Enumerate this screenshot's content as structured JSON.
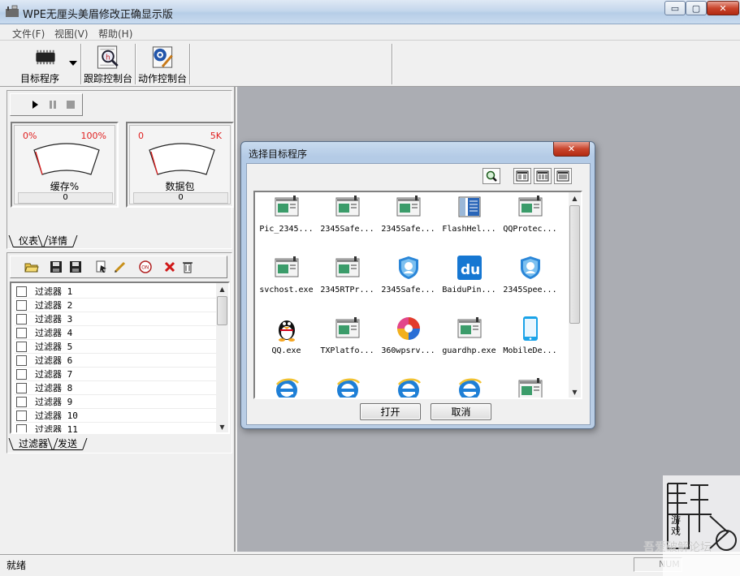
{
  "window": {
    "title": "WPE无厘头美眉修改正确显示版",
    "min_glyph": "▭",
    "max_glyph": "▢",
    "close_glyph": "✕"
  },
  "menu": [
    "文件(F)",
    "视图(V)",
    "帮助(H)"
  ],
  "toolbar": {
    "target_label": "目标程序",
    "trace_label": "跟踪控制台",
    "action_label": "动作控制台"
  },
  "gauges": [
    {
      "name": "缓存%",
      "min": "0%",
      "max": "100%",
      "value": "0"
    },
    {
      "name": "数据包",
      "min": "0",
      "max": "5K",
      "value": "0"
    }
  ],
  "top_tabs": [
    "仪表",
    "详情"
  ],
  "filters": [
    "过滤器 1",
    "过滤器 2",
    "过滤器 3",
    "过滤器 4",
    "过滤器 5",
    "过滤器 6",
    "过滤器 7",
    "过滤器 8",
    "过滤器 9",
    "过滤器 10",
    "过滤器 11"
  ],
  "bottom_tabs": [
    "过滤器",
    "发送"
  ],
  "dialog": {
    "title": "选择目标程序",
    "close_glyph": "✕",
    "open_label": "打开",
    "cancel_label": "取消",
    "programs": [
      {
        "name": "Pic_2345...",
        "icon": "window-app-icon"
      },
      {
        "name": "2345Safe...",
        "icon": "window-app-icon"
      },
      {
        "name": "2345Safe...",
        "icon": "window-app-icon"
      },
      {
        "name": "FlashHel...",
        "icon": "flash-helper-icon"
      },
      {
        "name": "QQProtec...",
        "icon": "window-app-icon"
      },
      {
        "name": "svchost.exe",
        "icon": "window-app-icon"
      },
      {
        "name": "2345RTPr...",
        "icon": "window-app-icon"
      },
      {
        "name": "2345Safe...",
        "icon": "shield-icon"
      },
      {
        "name": "BaiduPin...",
        "icon": "baidu-du-icon"
      },
      {
        "name": "2345Spee...",
        "icon": "shield-icon"
      },
      {
        "name": "QQ.exe",
        "icon": "qq-penguin-icon"
      },
      {
        "name": "TXPlatfo...",
        "icon": "window-app-icon"
      },
      {
        "name": "360wpsrv...",
        "icon": "360-icon"
      },
      {
        "name": "guardhp.exe",
        "icon": "window-app-icon"
      },
      {
        "name": "MobileDe...",
        "icon": "mobile-phone-icon"
      },
      {
        "name": "",
        "icon": "ie-icon"
      },
      {
        "name": "",
        "icon": "ie-icon"
      },
      {
        "name": "",
        "icon": "ie-icon"
      },
      {
        "name": "",
        "icon": "ie-icon"
      },
      {
        "name": "",
        "icon": "window-app-icon"
      }
    ]
  },
  "status": {
    "text": "就绪",
    "num": "NUM"
  },
  "watermark": {
    "text": "吾爱破解论坛",
    "game_char_1": "游",
    "game_char_2": "戏"
  },
  "colors": {
    "workspace": "#abadb3",
    "gauge_red": "#e02020",
    "titlebar": "#c5d7ec"
  }
}
